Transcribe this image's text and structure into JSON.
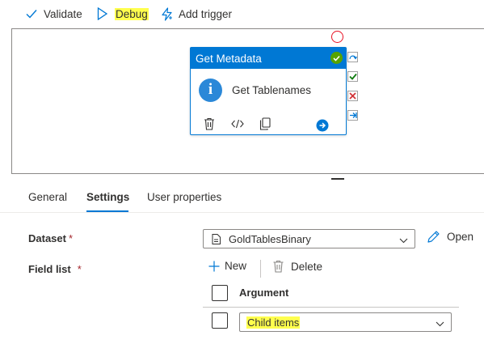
{
  "toolbar": {
    "validate_label": "Validate",
    "debug_label": "Debug",
    "add_trigger_label": "Add trigger",
    "highlight_color": "#ffff4d"
  },
  "activity": {
    "header": "Get Metadata",
    "name": "Get Tablenames",
    "icon": "info-icon",
    "status": "succeeded",
    "header_color": "#0078d4"
  },
  "tabs": [
    {
      "label": "General",
      "active": false
    },
    {
      "label": "Settings",
      "active": true
    },
    {
      "label": "User properties",
      "active": false
    }
  ],
  "settings": {
    "dataset_label": "Dataset",
    "dataset_value": "GoldTablesBinary",
    "open_label": "Open",
    "field_list_label": "Field list",
    "required_mark": "*",
    "new_label": "New",
    "delete_label": "Delete",
    "argument_header": "Argument",
    "argument_value": "Child items"
  }
}
